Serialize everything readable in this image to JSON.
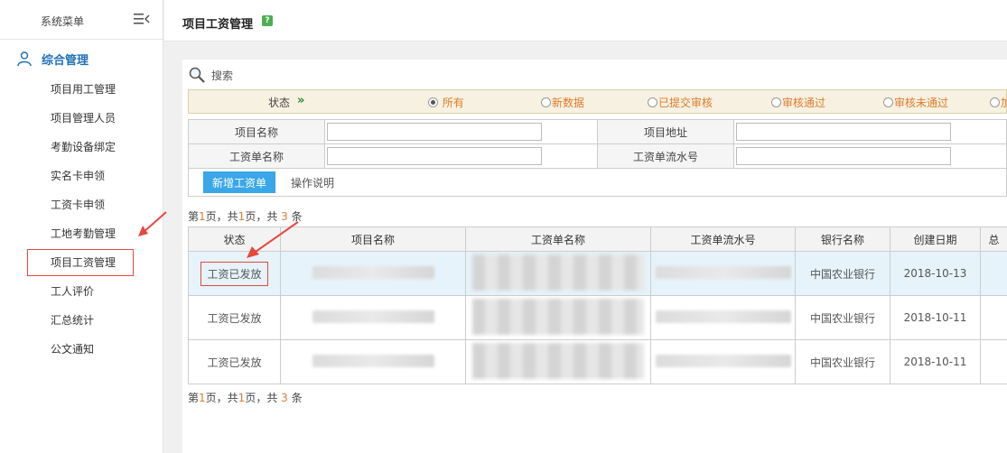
{
  "sidebar": {
    "title": "系统菜单",
    "group_label": "综合管理",
    "items": [
      {
        "label": "项目用工管理"
      },
      {
        "label": "项目管理人员"
      },
      {
        "label": "考勤设备绑定"
      },
      {
        "label": "实名卡申领"
      },
      {
        "label": "工资卡申领"
      },
      {
        "label": "工地考勤管理"
      },
      {
        "label": "项目工资管理"
      },
      {
        "label": "工人评价"
      },
      {
        "label": "汇总统计"
      },
      {
        "label": "公文通知"
      }
    ]
  },
  "header": {
    "title": "项目工资管理",
    "help": "?"
  },
  "search": {
    "label": "搜索"
  },
  "status_filter": {
    "label": "状态",
    "arrows": "»",
    "options": [
      "所有",
      "新数据",
      "已提交审核",
      "审核通过",
      "审核未通过",
      "加"
    ]
  },
  "form": {
    "project_name_label": "项目名称",
    "project_address_label": "项目地址",
    "payroll_name_label": "工资单名称",
    "payroll_serial_label": "工资单流水号"
  },
  "buttons": {
    "new_payroll": "新增工资单",
    "help": "操作说明"
  },
  "pager": {
    "prefix": "第",
    "page": "1",
    "mid": "页，共",
    "total_pages": "1",
    "mid2": "页，共",
    "count": "3",
    "suffix": "条"
  },
  "table": {
    "headers": [
      "状态",
      "项目名称",
      "工资单名称",
      "工资单流水号",
      "银行名称",
      "创建日期",
      "总"
    ],
    "rows": [
      {
        "status": "工资已发放",
        "bank": "中国农业银行",
        "date": "2018-10-13"
      },
      {
        "status": "工资已发放",
        "bank": "中国农业银行",
        "date": "2018-10-11"
      },
      {
        "status": "工资已发放",
        "bank": "中国农业银行",
        "date": "2018-10-11"
      }
    ]
  },
  "colors": {
    "accent": "#3aa7e8",
    "nav_blue": "#1f70b8",
    "annotation_red": "#e8473b",
    "status_orange": "#e07b2a"
  }
}
